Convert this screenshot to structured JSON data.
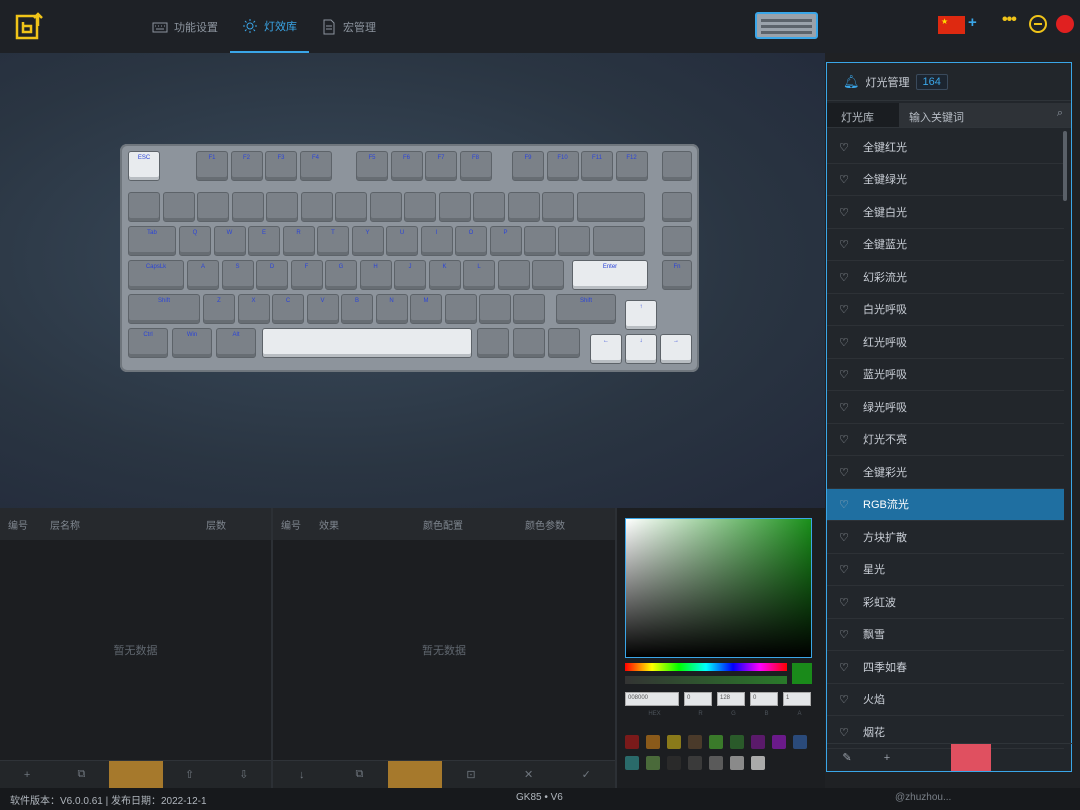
{
  "nav": {
    "tabs": [
      {
        "label": "功能设置",
        "icon": "keyboard-icon"
      },
      {
        "label": "灯效库",
        "icon": "light-icon"
      },
      {
        "label": "宏管理",
        "icon": "document-icon"
      }
    ],
    "active": 1
  },
  "window": {
    "language_flag": "china-flag-icon",
    "add_symbol": "+",
    "more": "•••"
  },
  "keyboard_keys": {
    "esc": "ESC",
    "tab": "Tab",
    "caps": "CapsLk",
    "shift_l": "Shift",
    "shift_r": "Shift",
    "enter": "Enter",
    "ctrl": "Ctrl",
    "win": "Win",
    "alt": "Alt",
    "letters_row1": [
      "Q",
      "W",
      "E",
      "R",
      "T",
      "Y",
      "U",
      "I",
      "O",
      "P"
    ],
    "letters_row2": [
      "A",
      "S",
      "D",
      "F",
      "G",
      "H",
      "J",
      "K",
      "L"
    ],
    "letters_row3": [
      "Z",
      "X",
      "C",
      "V",
      "B",
      "N",
      "M"
    ],
    "f_keys": [
      "F1",
      "F2",
      "F3",
      "F4",
      "F5",
      "F6",
      "F7",
      "F8",
      "F9",
      "F10",
      "F11",
      "F12"
    ],
    "arrows": [
      "↑",
      "←",
      "↓",
      "→"
    ],
    "fn": "Fn"
  },
  "effects_panel": {
    "title": "灯光管理",
    "count": "164",
    "tab": "灯光库",
    "search_placeholder": "输入关键词",
    "items": [
      "全键红光",
      "全键绿光",
      "全键白光",
      "全键蓝光",
      "幻彩流光",
      "白光呼吸",
      "红光呼吸",
      "蓝光呼吸",
      "绿光呼吸",
      "灯光不亮",
      "全键彩光",
      "RGB流光",
      "方块扩散",
      "星光",
      "彩虹波",
      "飘雪",
      "四季如春",
      "火焰",
      "烟花"
    ],
    "selected_index": 11,
    "footer": [
      "edit-icon",
      "+"
    ]
  },
  "panel_left": {
    "headers": [
      "编号",
      "层名称",
      "层数"
    ],
    "empty_text": "暂无数据",
    "footer": [
      "+",
      "copy-icon",
      "",
      "up-icon",
      "down-icon"
    ]
  },
  "panel_mid": {
    "headers": [
      "编号",
      "效果",
      "颜色配置",
      "颜色参数"
    ],
    "empty_text": "暂无数据",
    "footer": [
      "↓",
      "copy-icon",
      "",
      "import-icon",
      "✕",
      "✓"
    ]
  },
  "color_picker": {
    "hex": "008000",
    "r": "0",
    "g": "128",
    "b": "0",
    "a": "1",
    "labels": [
      "HEX",
      "R",
      "G",
      "B",
      "A"
    ],
    "swatches": [
      "#7a1a1a",
      "#8a5a1a",
      "#8a7a1a",
      "#4a3a2a",
      "#3a7a2a",
      "#2a5a2a",
      "#5a1a6a",
      "#6a1a8a",
      "#2a4a7a",
      "#2a6a6a",
      "#4a6a3a",
      "#2a2a2a",
      "#3a3a3a",
      "#5a5a5a",
      "#8a8a8a",
      "#aaaaaa"
    ]
  },
  "statusbar": {
    "left": "软件版本：V6.0.0.61 | 发布日期：2022-12-1",
    "middle": "GK85 • V6",
    "right": "@zhuzhou..."
  }
}
